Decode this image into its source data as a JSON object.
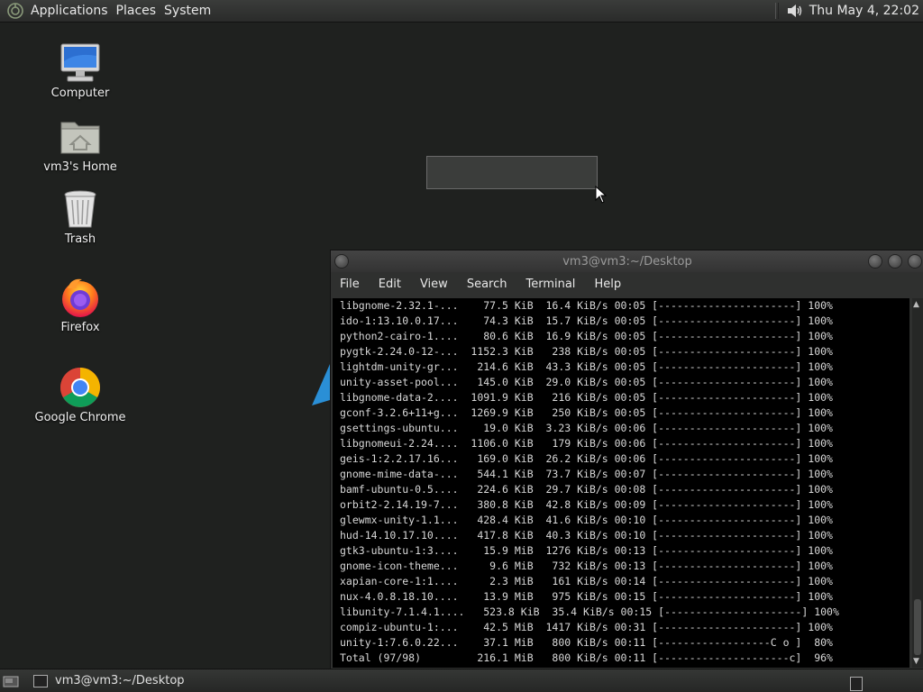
{
  "top_panel": {
    "menus": [
      "Applications",
      "Places",
      "System"
    ],
    "clock": "Thu May  4, 22:02",
    "icons": {
      "logo": "distro-logo-icon",
      "volume": "volume-icon"
    }
  },
  "desktop": {
    "icons": [
      {
        "label": "Computer",
        "icon": "computer-icon"
      },
      {
        "label": "vm3's Home",
        "icon": "home-folder-icon"
      },
      {
        "label": "Trash",
        "icon": "trash-icon"
      },
      {
        "label": "Firefox",
        "icon": "firefox-icon"
      },
      {
        "label": "Google Chrome",
        "icon": "chrome-icon"
      }
    ]
  },
  "terminal": {
    "title": "vm3@vm3:~/Desktop",
    "menus": [
      "File",
      "Edit",
      "View",
      "Search",
      "Terminal",
      "Help"
    ],
    "lines": [
      "libgnome-2.32.1-...    77.5 KiB  16.4 KiB/s 00:05 [----------------------] 100%",
      "ido-1:13.10.0.17...    74.3 KiB  15.7 KiB/s 00:05 [----------------------] 100%",
      "python2-cairo-1....    80.6 KiB  16.9 KiB/s 00:05 [----------------------] 100%",
      "pygtk-2.24.0-12-...  1152.3 KiB   238 KiB/s 00:05 [----------------------] 100%",
      "lightdm-unity-gr...   214.6 KiB  43.3 KiB/s 00:05 [----------------------] 100%",
      "unity-asset-pool...   145.0 KiB  29.0 KiB/s 00:05 [----------------------] 100%",
      "libgnome-data-2....  1091.9 KiB   216 KiB/s 00:05 [----------------------] 100%",
      "gconf-3.2.6+11+g...  1269.9 KiB   250 KiB/s 00:05 [----------------------] 100%",
      "gsettings-ubuntu...    19.0 KiB  3.23 KiB/s 00:06 [----------------------] 100%",
      "libgnomeui-2.24....  1106.0 KiB   179 KiB/s 00:06 [----------------------] 100%",
      "geis-1:2.2.17.16...   169.0 KiB  26.2 KiB/s 00:06 [----------------------] 100%",
      "gnome-mime-data-...   544.1 KiB  73.7 KiB/s 00:07 [----------------------] 100%",
      "bamf-ubuntu-0.5....   224.6 KiB  29.7 KiB/s 00:08 [----------------------] 100%",
      "orbit2-2.14.19-7...   380.8 KiB  42.8 KiB/s 00:09 [----------------------] 100%",
      "glewmx-unity-1.1...   428.4 KiB  41.6 KiB/s 00:10 [----------------------] 100%",
      "hud-14.10.17.10....   417.8 KiB  40.3 KiB/s 00:10 [----------------------] 100%",
      "gtk3-ubuntu-1:3....    15.9 MiB  1276 KiB/s 00:13 [----------------------] 100%",
      "gnome-icon-theme...     9.6 MiB   732 KiB/s 00:13 [----------------------] 100%",
      "xapian-core-1:1....     2.3 MiB   161 KiB/s 00:14 [----------------------] 100%",
      "nux-4.0.8.18.10....    13.9 MiB   975 KiB/s 00:15 [----------------------] 100%",
      "libunity-7.1.4.1....   523.8 KiB  35.4 KiB/s 00:15 [----------------------] 100%",
      "compiz-ubuntu-1:...    42.5 MiB  1417 KiB/s 00:31 [----------------------] 100%",
      "unity-1:7.6.0.22...    37.1 MiB   800 KiB/s 00:11 [------------------C o ]  80%",
      "Total (97/98)         216.1 MiB   800 KiB/s 00:11 [---------------------c]  96%"
    ]
  },
  "taskbar": {
    "items": [
      {
        "label": "vm3@vm3:~/Desktop",
        "icon": "terminal-icon"
      }
    ],
    "icons": {
      "show_desktop": "show-desktop-icon",
      "workspace": "workspace-switcher-icon"
    }
  }
}
